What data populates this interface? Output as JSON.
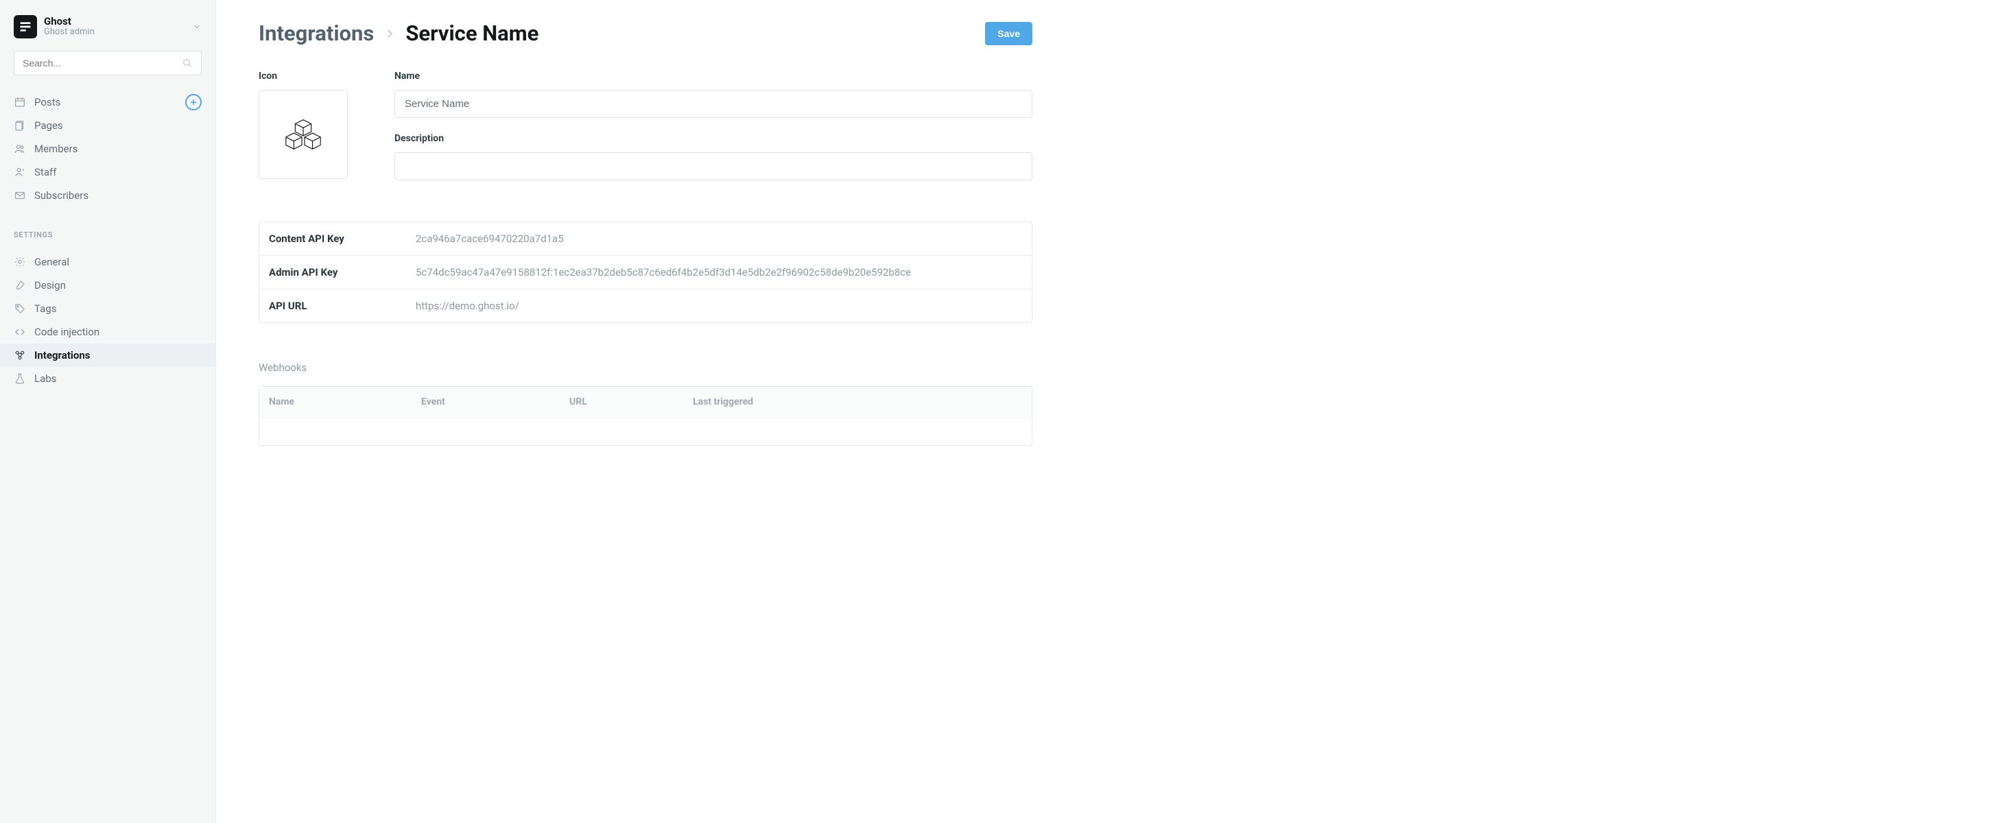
{
  "site": {
    "title": "Ghost",
    "subtitle": "Ghost admin"
  },
  "search": {
    "placeholder": "Search..."
  },
  "nav": {
    "main": [
      {
        "key": "posts",
        "label": "Posts",
        "icon": "calendar-icon",
        "add": true
      },
      {
        "key": "pages",
        "label": "Pages",
        "icon": "documents-icon"
      },
      {
        "key": "members",
        "label": "Members",
        "icon": "members-icon"
      },
      {
        "key": "staff",
        "label": "Staff",
        "icon": "staff-icon"
      },
      {
        "key": "subscribers",
        "label": "Subscribers",
        "icon": "mail-icon"
      }
    ],
    "settings_heading": "SETTINGS",
    "settings": [
      {
        "key": "general",
        "label": "General",
        "icon": "gear-icon"
      },
      {
        "key": "design",
        "label": "Design",
        "icon": "brush-icon"
      },
      {
        "key": "tags",
        "label": "Tags",
        "icon": "tag-icon"
      },
      {
        "key": "codeinjection",
        "label": "Code injection",
        "icon": "code-icon"
      },
      {
        "key": "integrations",
        "label": "Integrations",
        "icon": "integrations-icon",
        "active": true
      },
      {
        "key": "labs",
        "label": "Labs",
        "icon": "labs-icon"
      }
    ]
  },
  "header": {
    "crumb_root": "Integrations",
    "crumb_current": "Service Name",
    "save_label": "Save"
  },
  "form": {
    "icon_label": "Icon",
    "name_label": "Name",
    "name_value": "Service Name",
    "desc_label": "Description",
    "desc_value": ""
  },
  "api": {
    "rows": [
      {
        "label": "Content API Key",
        "value": "2ca946a7cace69470220a7d1a5"
      },
      {
        "label": "Admin API Key",
        "value": "5c74dc59ac47a47e9158812f:1ec2ea37b2deb5c87c6ed6f4b2e5df3d14e5db2e2f96902c58de9b20e592b8ce"
      },
      {
        "label": "API URL",
        "value": "https://demo.ghost.io/"
      }
    ]
  },
  "webhooks": {
    "title": "Webhooks",
    "columns": [
      "Name",
      "Event",
      "URL",
      "Last triggered"
    ]
  }
}
